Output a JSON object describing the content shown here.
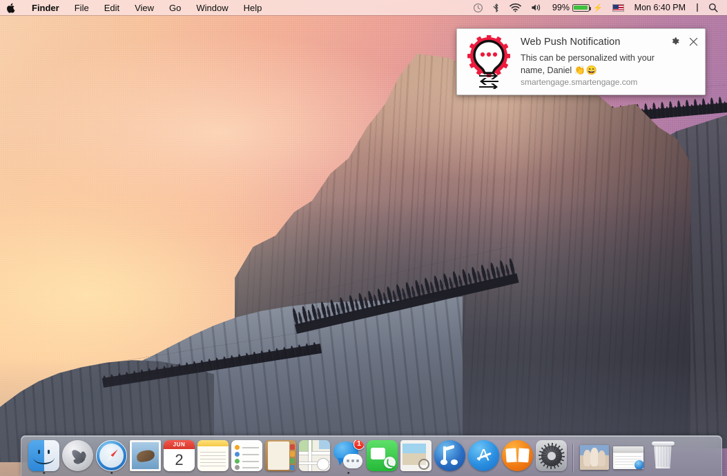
{
  "menubar": {
    "apple_glyph": "",
    "app_name": "Finder",
    "menus": [
      "File",
      "Edit",
      "View",
      "Go",
      "Window",
      "Help"
    ],
    "status": {
      "time_machine_icon": "time-machine-icon",
      "bluetooth_icon": "bluetooth-icon",
      "wifi_icon": "wifi-icon",
      "volume_icon": "volume-icon",
      "battery_percent": "99%",
      "battery_charging_glyph": "⚡",
      "input_flag": "US",
      "clock": "Mon 6:40 PM",
      "separator": "|",
      "spotlight_icon": "search-icon",
      "notification_center_icon": "list-icon"
    }
  },
  "notification": {
    "title": "Web Push Notification",
    "body_line1": "This can be personalized with your name,",
    "body_line2": "Daniel",
    "emoji": "👏😄",
    "url": "smartengage.smartengage.com",
    "settings_icon": "gear-icon",
    "close_icon": "close-icon",
    "app_icon": "smartengage-lightbulb-gear-icon",
    "accent_color": "#ED1B3E"
  },
  "dock": {
    "items": [
      {
        "name": "finder",
        "label": "Finder",
        "running": true
      },
      {
        "name": "launchpad",
        "label": "Launchpad",
        "running": false
      },
      {
        "name": "safari",
        "label": "Safari",
        "running": true
      },
      {
        "name": "mail",
        "label": "Mail",
        "running": false
      },
      {
        "name": "calendar",
        "label": "Calendar",
        "month": "JUN",
        "day": "2",
        "running": false
      },
      {
        "name": "notes",
        "label": "Notes",
        "running": false
      },
      {
        "name": "reminders",
        "label": "Reminders",
        "running": false
      },
      {
        "name": "contacts",
        "label": "Contacts",
        "running": false
      },
      {
        "name": "maps",
        "label": "Maps",
        "running": false
      },
      {
        "name": "messages",
        "label": "Messages",
        "badge": "1",
        "running": true
      },
      {
        "name": "facetime",
        "label": "FaceTime",
        "running": false
      },
      {
        "name": "photos",
        "label": "Photos",
        "running": false
      },
      {
        "name": "itunes",
        "label": "iTunes",
        "running": false
      },
      {
        "name": "app-store",
        "label": "App Store",
        "running": false
      },
      {
        "name": "ibooks",
        "label": "iBooks",
        "running": false
      },
      {
        "name": "system-preferences",
        "label": "System Preferences",
        "running": false
      }
    ],
    "minimized": [
      {
        "name": "minimized-photo-window",
        "label": "Photo window"
      },
      {
        "name": "minimized-safari-window",
        "label": "Safari window"
      }
    ],
    "trash": {
      "name": "trash",
      "label": "Trash"
    }
  },
  "desktop": {
    "wallpaper": "Yosemite Half Dome at sunset",
    "sky_warm_color": "#F7CFA8",
    "sky_cool_color": "#9D6FA2",
    "rock_color": "#6A656C"
  }
}
